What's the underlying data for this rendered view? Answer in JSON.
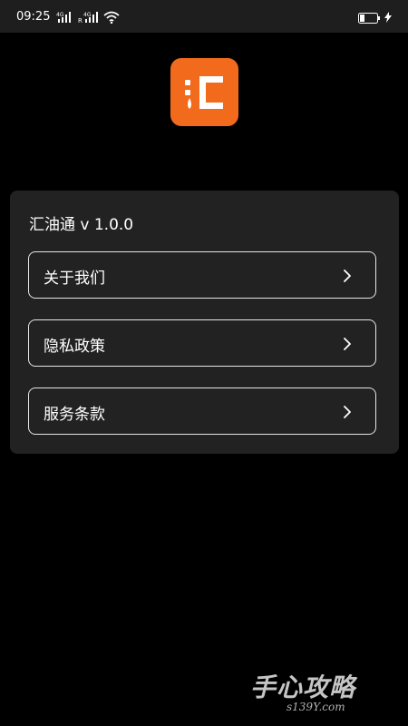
{
  "status_bar": {
    "time": "09:25",
    "signal1_tag": "4G",
    "signal2_tag": "4G",
    "signal2_roaming": "R",
    "icons": [
      "signal-icon",
      "signal-icon",
      "wifi-icon",
      "battery-icon",
      "charging-icon"
    ]
  },
  "app": {
    "logo_icon": "hui-logo-icon",
    "brand_color": "#f26a1b",
    "version_label": "汇油通 v 1.0.0"
  },
  "menu": {
    "items": [
      {
        "label": "关于我们"
      },
      {
        "label": "隐私政策"
      },
      {
        "label": "服务条款"
      }
    ],
    "chevron_icon": "chevron-right-icon"
  },
  "watermark": {
    "text": "手心攻略",
    "sub": "s139Y.com"
  }
}
